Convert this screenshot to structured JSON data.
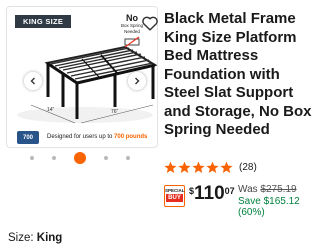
{
  "gallery": {
    "size_tag": "KING SIZE",
    "no_box_spring": {
      "no": "No",
      "text": "Box Spring Needed"
    },
    "dimension_left": "14\"",
    "dimension_right": "76\"",
    "weight_badge": "700",
    "weight_note_prefix": "Designed for users up to ",
    "weight_note_value": "700 pounds",
    "active_image_index": 3,
    "image_count": 5
  },
  "product": {
    "title": "Black Metal Frame King Size Platform Bed Mattress Foundation with Steel Slat Support and Storage, No Box Spring Needed",
    "rating": 5,
    "review_count": "(28)"
  },
  "price": {
    "special_buy_top": "SPECIAL",
    "special_buy_bottom": "BUY",
    "currency": "$",
    "dollars": "110",
    "cents": "07",
    "was_label": "Was ",
    "was_amount": "$275.19",
    "save_text": "Save $165.12",
    "save_percent": "(60%)"
  },
  "options": {
    "size_label": "Size: ",
    "size_value": "King"
  },
  "colors": {
    "accent": "#f96302",
    "star": "#f96302",
    "savings": "#00823d",
    "special_buy_red": "#e52e1f"
  },
  "icons": [
    "chevron-left-icon",
    "chevron-right-icon",
    "heart-icon",
    "star-icon",
    "no-box-spring-icon"
  ]
}
